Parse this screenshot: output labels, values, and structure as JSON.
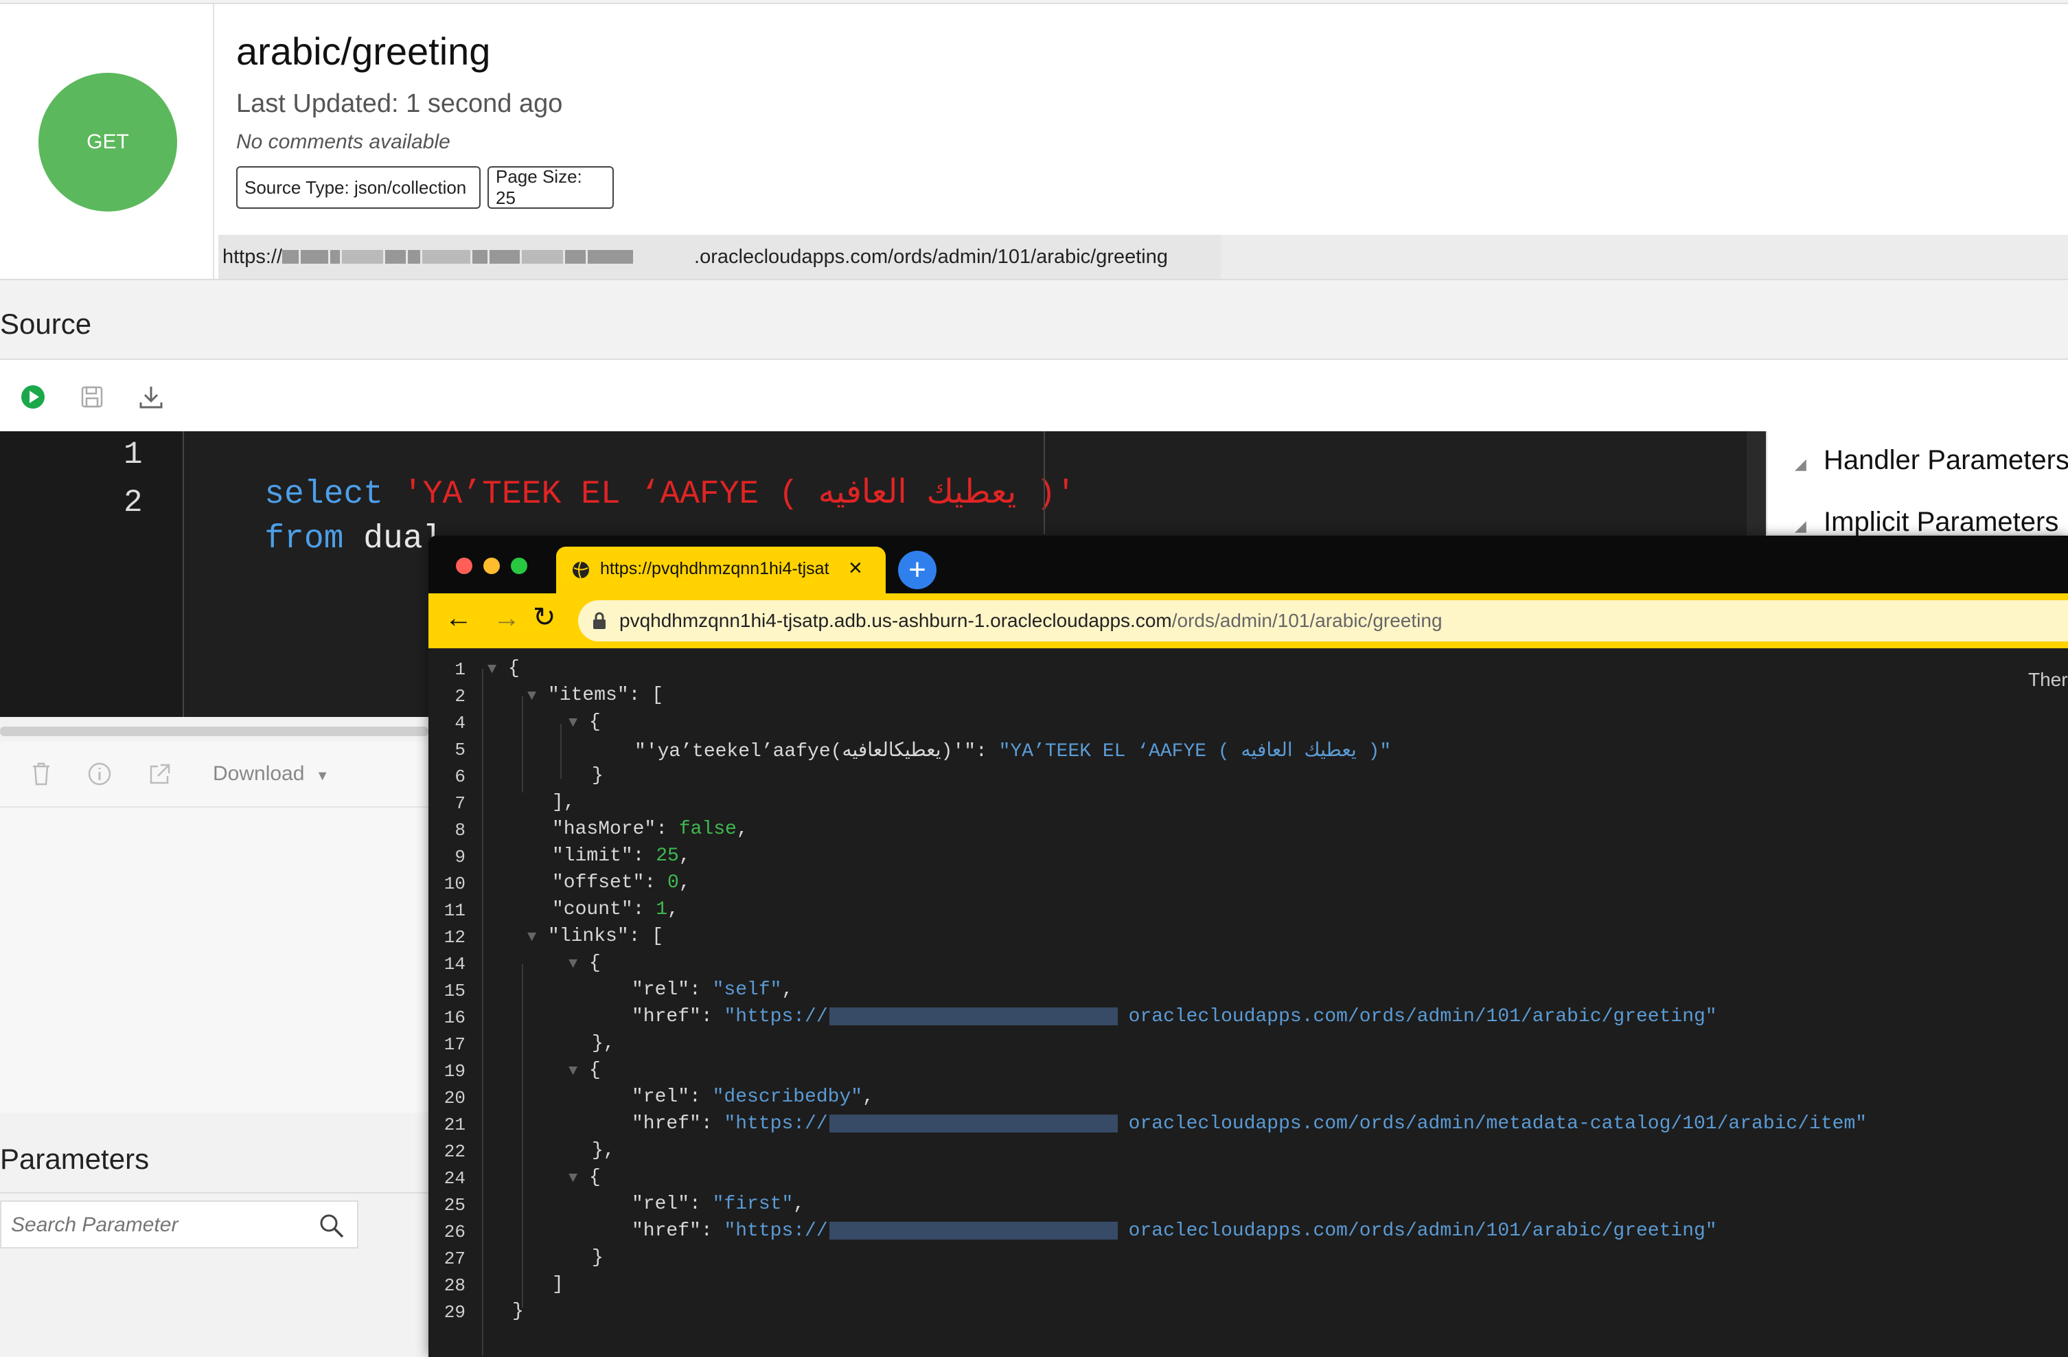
{
  "endpoint": {
    "method": "GET",
    "title": "arabic/greeting",
    "last_updated": "Last Updated: 1 second ago",
    "comments": "No comments available",
    "source_type": "Source Type: json/collection",
    "page_size": "Page Size: 25",
    "url_prefix": "https://",
    "url_suffix": ".oraclecloudapps.com/ords/admin/101/arabic/greeting"
  },
  "source": {
    "title": "Source",
    "line_numbers": [
      "1",
      "2"
    ],
    "line1_keyword": "select",
    "line1_string": "'YA’TEEK EL ‘AAFYE ( يعطيك العافيه )'",
    "line2_keyword": "from",
    "line2_plain": "dual"
  },
  "right_panel": {
    "items": [
      "Handler Parameters",
      "Implicit Parameters"
    ]
  },
  "results_toolbar": {
    "download_label": "Download"
  },
  "parameters": {
    "title": "Parameters",
    "search_placeholder": "Search Parameter"
  },
  "browser": {
    "tab_title": "https://pvqhdhmzqnn1hi4-tjsat",
    "url_host": "pvqhdhmzqnn1hi4-tjsatp.adb.us-ashburn-1.oraclecloudapps.com",
    "url_path": "/ords/admin/101/arabic/greeting",
    "theme_label": "Ther",
    "json_line_numbers": [
      "1",
      "2",
      "4",
      "5",
      "6",
      "7",
      "8",
      "9",
      "10",
      "11",
      "12",
      "14",
      "15",
      "16",
      "17",
      "19",
      "20",
      "21",
      "22",
      "24",
      "25",
      "26",
      "27",
      "28",
      "29"
    ],
    "json": {
      "open_brace": "{",
      "items_key": "\"items\"",
      "item_key": "\"'ya’teekel’aafye(يعطيكالعافيه)'\"",
      "item_value": "\"YA’TEEK EL ‘AAFYE ( يعطيك العافيه )\"",
      "hasMore_key": "\"hasMore\"",
      "hasMore_val": "false",
      "limit_key": "\"limit\"",
      "limit_val": "25",
      "offset_key": "\"offset\"",
      "offset_val": "0",
      "count_key": "\"count\"",
      "count_val": "1",
      "links_key": "\"links\"",
      "rel_key": "\"rel\"",
      "href_key": "\"href\"",
      "rel_self": "\"self\"",
      "rel_describedby": "\"describedby\"",
      "rel_first": "\"first\"",
      "href_prefix": "\"https://",
      "href_self_suffix": "oraclecloudapps.com/ords/admin/101/arabic/greeting\"",
      "href_describedby_suffix": "oraclecloudapps.com/ords/admin/metadata-catalog/101/arabic/item\"",
      "href_first_suffix": "oraclecloudapps.com/ords/admin/101/arabic/greeting\""
    }
  },
  "colors": {
    "method_badge": "#5cb85c",
    "keyword": "#4d9fe8",
    "sql_string": "#e02424",
    "json_string": "#5b9bd5",
    "json_literal": "#3fb950",
    "browser_accent": "#ffd200"
  }
}
